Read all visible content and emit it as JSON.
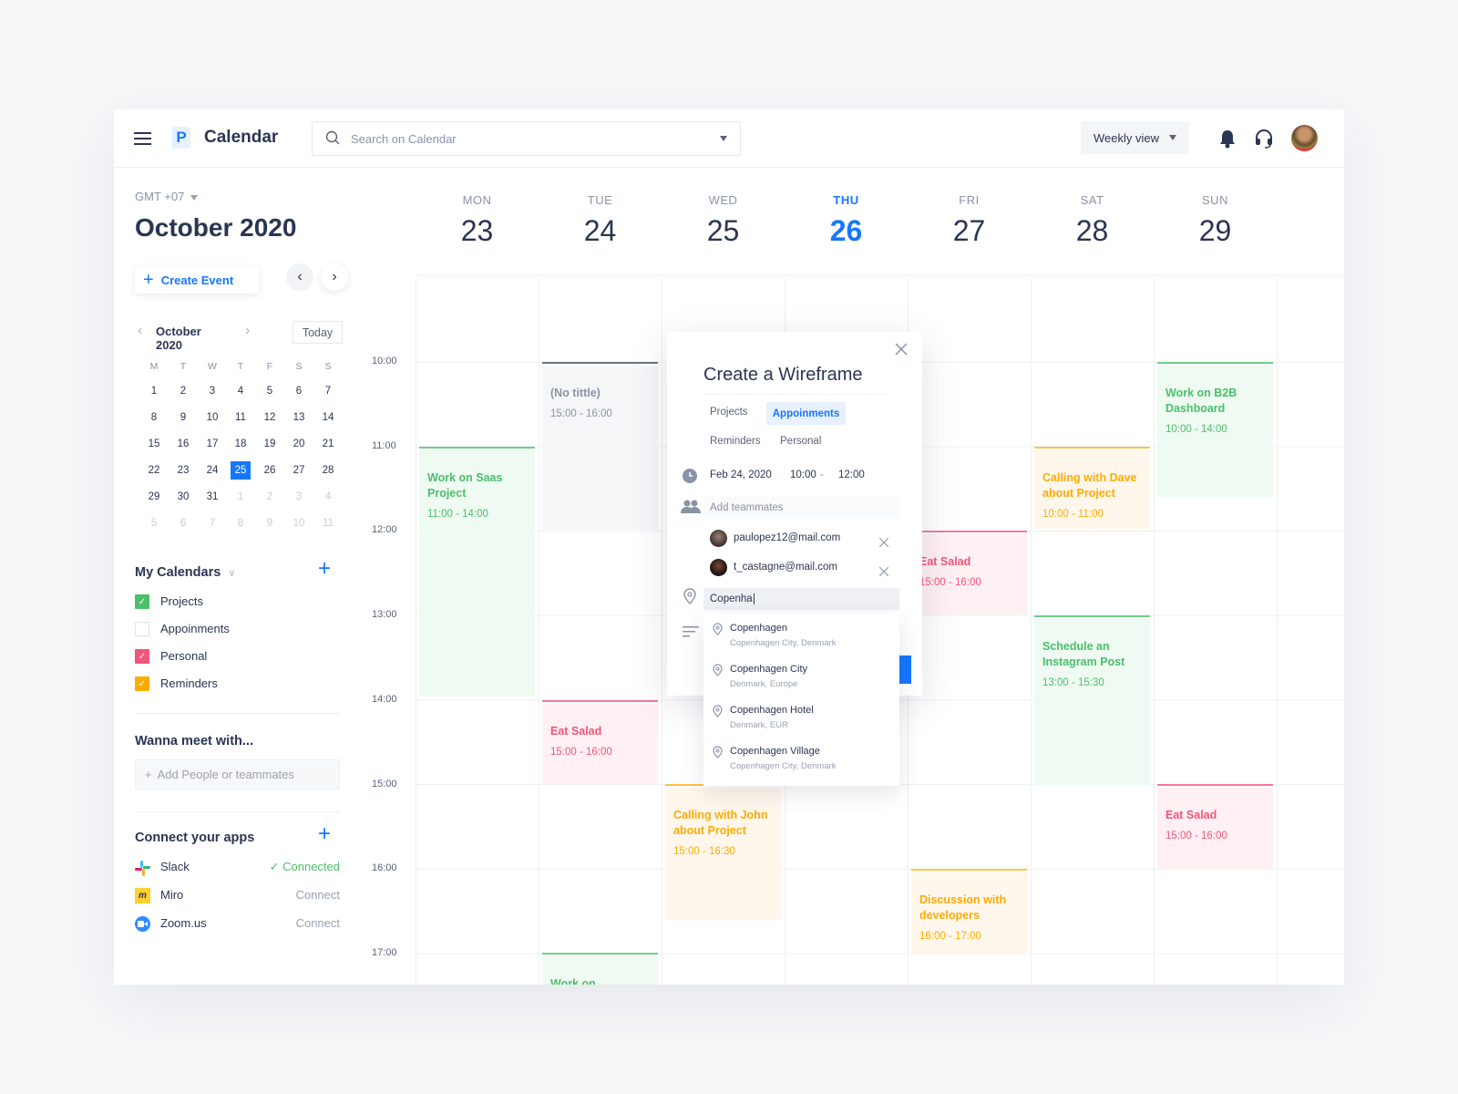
{
  "header": {
    "app_title": "Calendar",
    "logo_letter": "P",
    "search_placeholder": "Search on Calendar",
    "view_select": "Weekly view"
  },
  "colors": {
    "accent": "#1677ff",
    "projects": "#4cbf6b",
    "personal": "#f2557a",
    "reminders": "#ffab00"
  },
  "sidebar": {
    "timezone": "GMT +07",
    "month_title": "October 2020",
    "create_event": "Create Event",
    "mini_calendar": {
      "title": "October 2020",
      "today_button": "Today",
      "weekdays": [
        "M",
        "T",
        "W",
        "T",
        "F",
        "S",
        "S"
      ],
      "weeks": [
        [
          "1",
          "2",
          "3",
          "4",
          "5",
          "6",
          "7"
        ],
        [
          "8",
          "9",
          "10",
          "11",
          "12",
          "13",
          "14"
        ],
        [
          "15",
          "16",
          "17",
          "18",
          "19",
          "20",
          "21"
        ],
        [
          "22",
          "23",
          "24",
          "25",
          "26",
          "27",
          "28"
        ],
        [
          "29",
          "30",
          "31",
          "1",
          "2",
          "3",
          "4"
        ],
        [
          "5",
          "6",
          "7",
          "8",
          "9",
          "10",
          "11"
        ]
      ],
      "selected": "25"
    },
    "my_calendars": {
      "title": "My Calendars",
      "items": [
        {
          "label": "Projects",
          "checked": true,
          "color": "#4cbf6b"
        },
        {
          "label": "Appoinments",
          "checked": false
        },
        {
          "label": "Personal",
          "checked": true,
          "color": "#f2557a"
        },
        {
          "label": "Reminders",
          "checked": true,
          "color": "#ffab00"
        }
      ]
    },
    "meet": {
      "title": "Wanna meet with...",
      "placeholder": "Add People or teammates"
    },
    "apps": {
      "title": "Connect your apps",
      "items": [
        {
          "name": "Slack",
          "status": "Connected"
        },
        {
          "name": "Miro",
          "status": "Connect"
        },
        {
          "name": "Zoom.us",
          "status": "Connect"
        }
      ]
    }
  },
  "week": {
    "days": [
      {
        "label": "MON",
        "date": "23"
      },
      {
        "label": "TUE",
        "date": "24"
      },
      {
        "label": "WED",
        "date": "25"
      },
      {
        "label": "THU",
        "date": "26",
        "today": true
      },
      {
        "label": "FRI",
        "date": "27"
      },
      {
        "label": "SAT",
        "date": "28"
      },
      {
        "label": "SUN",
        "date": "29"
      }
    ],
    "hours": [
      "10:00",
      "11:00",
      "12:00",
      "13:00",
      "14:00",
      "15:00",
      "16:00",
      "17:00"
    ]
  },
  "events": [
    {
      "day": "MON",
      "title": "Work on Saas Project",
      "time": "11:00 - 14:00",
      "category": "projects"
    },
    {
      "day": "TUE",
      "title": "(No tittle)",
      "time": "15:00 - 16:00",
      "category": "none"
    },
    {
      "day": "TUE",
      "title": "Eat Salad",
      "time": "15:00 - 16:00",
      "category": "personal"
    },
    {
      "day": "TUE",
      "title": "Work on",
      "time": "",
      "category": "projects"
    },
    {
      "day": "WED",
      "title": "Calling with John about Project",
      "time": "15:00 - 16:30",
      "category": "reminders"
    },
    {
      "day": "FRI",
      "title": "Eat Salad",
      "time": "15:00 - 16:00",
      "category": "personal"
    },
    {
      "day": "FRI",
      "title": "Discussion with developers",
      "time": "16:00 - 17:00",
      "category": "reminders"
    },
    {
      "day": "SAT",
      "title": "Calling with Dave about Project",
      "time": "10:00 - 11:00",
      "category": "reminders"
    },
    {
      "day": "SAT",
      "title": "Schedule an Instagram Post",
      "time": "13:00 - 15:30",
      "category": "projects"
    },
    {
      "day": "SUN",
      "title": "Work on B2B Dashboard",
      "time": "10:00 - 14:00",
      "category": "projects"
    },
    {
      "day": "SUN",
      "title": "Eat Salad",
      "time": "15:00 - 16:00",
      "category": "personal"
    }
  ],
  "popup": {
    "title": "Create a Wireframe",
    "tabs": [
      "Projects",
      "Appoinments",
      "Reminders",
      "Personal"
    ],
    "active_tab": "Appoinments",
    "date": "Feb 24, 2020",
    "start": "10:00",
    "separator": "-",
    "end": "12:00",
    "teammates_placeholder": "Add teammates",
    "teammates": [
      "paulopez12@mail.com",
      "t_castagne@mail.com"
    ],
    "location_value": "Copenha",
    "suggestions": [
      {
        "name": "Copenhagen",
        "detail": "Copenhagen City, Denmark"
      },
      {
        "name": "Copenhagen City",
        "detail": "Denmark, Europe"
      },
      {
        "name": "Copenhagen Hotel",
        "detail": "Denmark, EUR"
      },
      {
        "name": "Copenhagen Village",
        "detail": "Copenhagen City, Denmark"
      }
    ]
  }
}
